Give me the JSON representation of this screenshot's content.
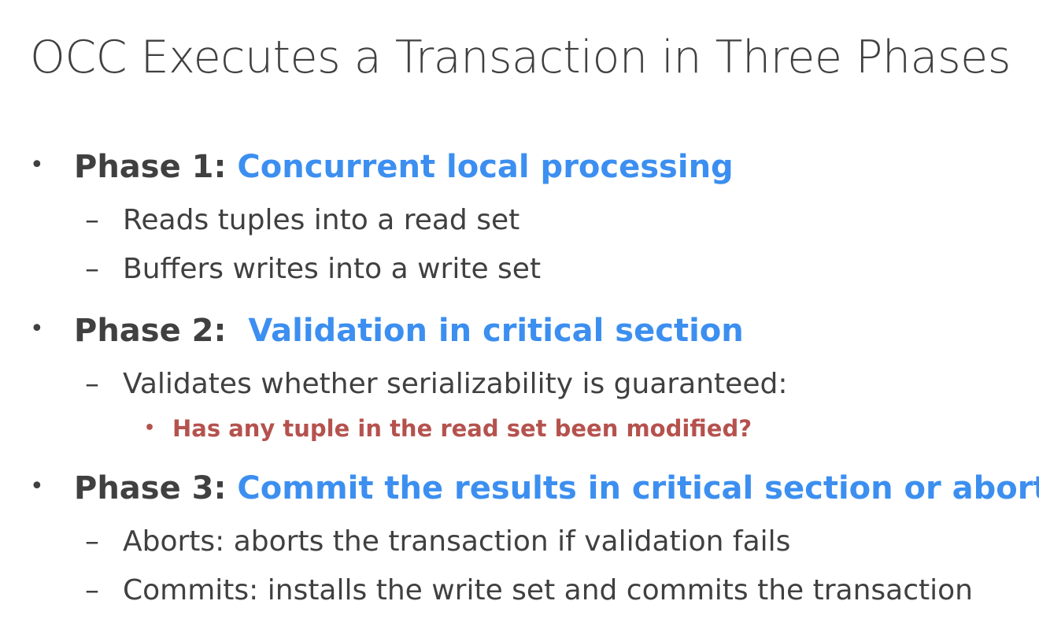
{
  "title": "OCC Executes a Transaction in Three Phases",
  "bullets": [
    {
      "label": "Phase 1:",
      "highlight": "Concurrent local processing",
      "subs": [
        "Reads tuples into a read set",
        "Buffers writes into a write set"
      ]
    },
    {
      "label": "Phase 2:",
      "highlight": "Validation in critical section",
      "subs": [
        "Validates whether serializability is guaranteed:"
      ],
      "subsub": "Has any tuple in the read set been modified?"
    },
    {
      "label": "Phase 3:",
      "highlight": "Commit the results in critical section or abort",
      "subs": [
        "Aborts: aborts the transaction if validation fails",
        "Commits: installs the write set and commits the transaction"
      ]
    }
  ],
  "glyphs": {
    "bullet": "•",
    "dash": "–"
  },
  "colors": {
    "text": "#404040",
    "highlight": "#3c8ff0",
    "emphasis": "#b5524e"
  }
}
